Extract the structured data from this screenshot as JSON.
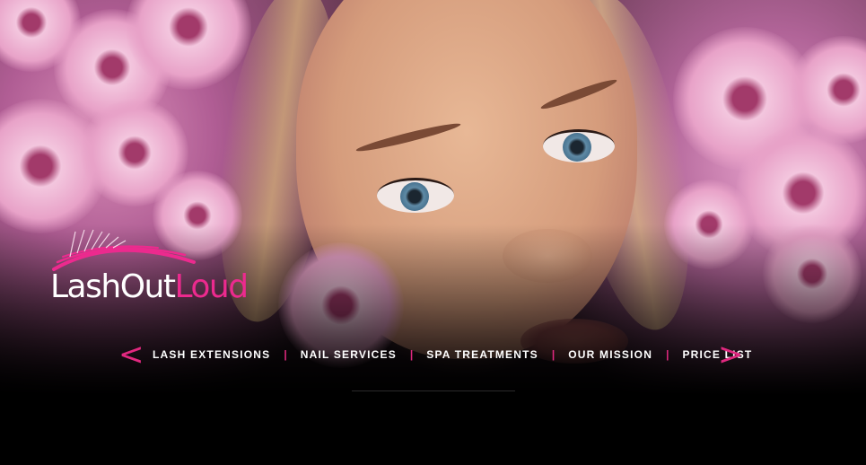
{
  "brand": {
    "logo_word_1": "Lash",
    "logo_word_2": "Out",
    "logo_word_3": "Loud",
    "accent_color": "#ec2a8e"
  },
  "hero": {
    "image_subject": "woman-face-with-pink-cherry-blossoms"
  },
  "nav": {
    "prev_arrow": "<",
    "next_arrow": ">",
    "separator": "|",
    "items": [
      {
        "label": "LASH EXTENSIONS"
      },
      {
        "label": "NAIL SERVICES"
      },
      {
        "label": "SPA TREATMENTS"
      },
      {
        "label": "OUR MISSION"
      },
      {
        "label": "PRICE LIST"
      }
    ]
  },
  "colors": {
    "background": "#000000",
    "nav_text": "#ffffff",
    "nav_accent": "#e0287f"
  }
}
